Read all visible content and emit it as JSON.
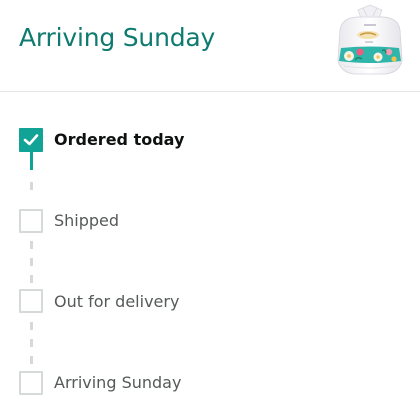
{
  "header": {
    "title": "Arriving Sunday",
    "product_image_icon": "product-package-icon"
  },
  "colors": {
    "accent": "#0f7b70",
    "check_fill": "#11a396",
    "inactive_box": "#d5d9d9",
    "label_done": "#0f1111",
    "label_pending": "#565959"
  },
  "tracker": {
    "steps": [
      {
        "label": "Ordered today",
        "status": "completed"
      },
      {
        "label": "Shipped",
        "status": "pending"
      },
      {
        "label": "Out for delivery",
        "status": "pending"
      },
      {
        "label": "Arriving Sunday",
        "status": "pending"
      }
    ]
  }
}
